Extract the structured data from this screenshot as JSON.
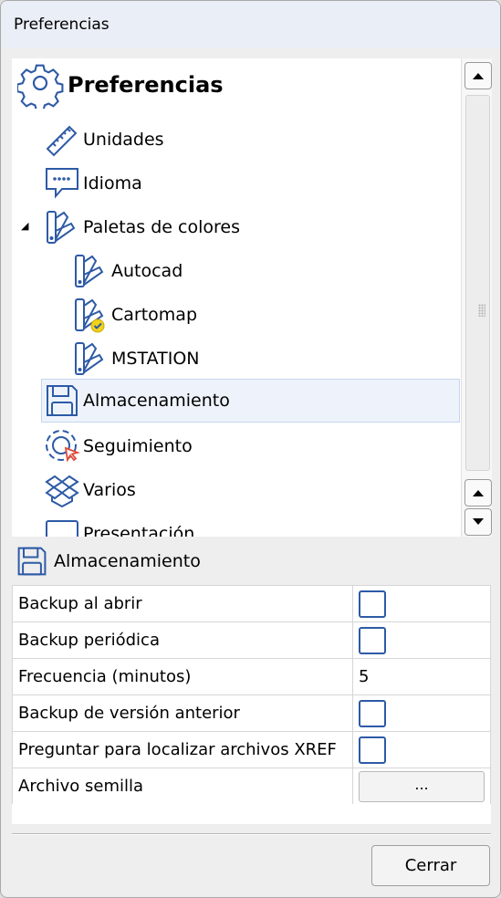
{
  "window": {
    "title": "Preferencias"
  },
  "tree": {
    "root_label": "Preferencias",
    "items": [
      {
        "label": "Unidades"
      },
      {
        "label": "Idioma"
      },
      {
        "label": "Paletas de colores",
        "expanded": true,
        "children": [
          {
            "label": "Autocad"
          },
          {
            "label": "Cartomap",
            "active": true
          },
          {
            "label": "MSTATION"
          }
        ]
      },
      {
        "label": "Almacenamiento",
        "selected": true
      },
      {
        "label": "Seguimiento"
      },
      {
        "label": "Varios"
      },
      {
        "label": "Presentación"
      }
    ]
  },
  "section": {
    "title": "Almacenamiento"
  },
  "properties": [
    {
      "name": "Backup al abrir",
      "type": "checkbox",
      "checked": false
    },
    {
      "name": "Backup periódica",
      "type": "checkbox",
      "checked": false
    },
    {
      "name": "Frecuencia (minutos)",
      "type": "number",
      "value": "5"
    },
    {
      "name": "Backup de versión anterior",
      "type": "checkbox",
      "checked": false
    },
    {
      "name": "Preguntar para localizar archivos XREF",
      "type": "checkbox",
      "checked": false
    },
    {
      "name": "Archivo semilla",
      "type": "button",
      "button_label": "..."
    }
  ],
  "footer": {
    "close_label": "Cerrar"
  },
  "colors": {
    "icon_blue": "#2d5aa6",
    "check_yellow": "#f1d21a",
    "cursor_red": "#e04a3a",
    "selection_bg": "#eef3fb"
  }
}
